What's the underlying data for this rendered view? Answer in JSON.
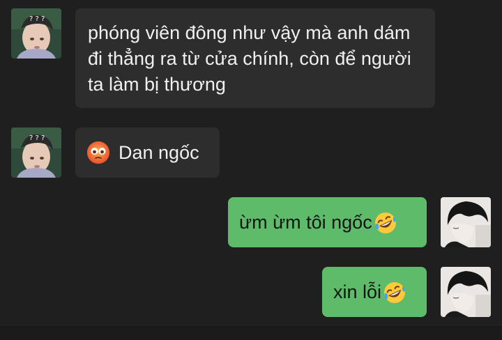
{
  "messages": [
    {
      "side": "in",
      "text": "phóng viên đông như vậy mà anh dám đi thẳng ra từ cửa chính, còn để người ta làm bị thương"
    },
    {
      "side": "in",
      "emoji": "flushed-face-emoji",
      "text": "Dan ngốc"
    },
    {
      "side": "out",
      "text": "ừm ừm tôi ngốc",
      "emoji": "rofl-emoji"
    },
    {
      "side": "out",
      "text": "xin lỗi",
      "emoji": "rofl-emoji"
    }
  ],
  "colors": {
    "background": "#1f1f1f",
    "incoming_bubble": "#2d2d2d",
    "outgoing_bubble": "#5dbb6a"
  }
}
